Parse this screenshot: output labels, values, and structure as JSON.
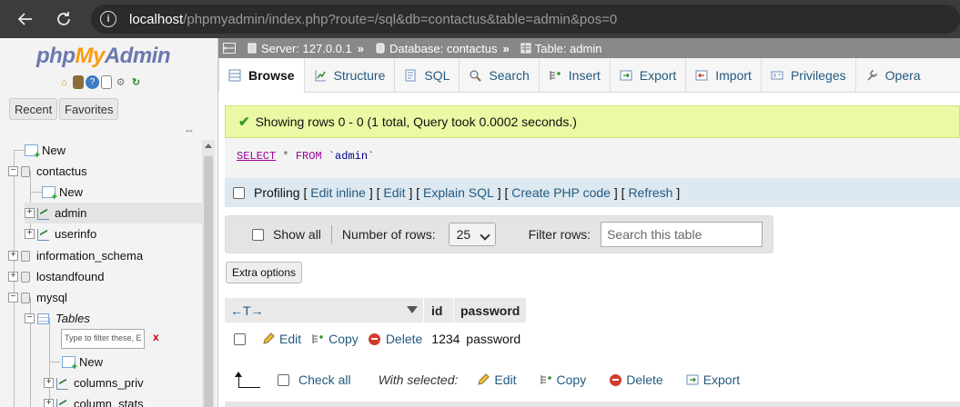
{
  "browser": {
    "url_host": "localhost",
    "url_path": "/phpmyadmin/index.php?route=/sql&db=contactus&table=admin&pos=0"
  },
  "sidebar": {
    "logo": {
      "php": "php",
      "my": "My",
      "admin": "Admin"
    },
    "recent_label": "Recent",
    "favorites_label": "Favorites",
    "tree": {
      "new_root": "New",
      "db_contactus": "contactus",
      "contactus_new": "New",
      "table_admin": "admin",
      "table_userinfo": "userinfo",
      "db_information_schema": "information_schema",
      "db_lostandfound": "lostandfound",
      "db_mysql": "mysql",
      "tables_label": "Tables",
      "filter_placeholder": "Type to filter these, E",
      "filter_clear": "x",
      "mysql_new": "New",
      "table_columns_priv": "columns_priv",
      "table_column_stats": "column_stats"
    }
  },
  "serverbar": {
    "server": "Server: 127.0.0.1",
    "database": "Database: contactus",
    "table": "Table: admin",
    "separator": "»"
  },
  "tabs": [
    {
      "label": "Browse",
      "icon": "browse-icon"
    },
    {
      "label": "Structure",
      "icon": "structure-icon"
    },
    {
      "label": "SQL",
      "icon": "sql-icon"
    },
    {
      "label": "Search",
      "icon": "search-icon"
    },
    {
      "label": "Insert",
      "icon": "insert-icon"
    },
    {
      "label": "Export",
      "icon": "export-icon"
    },
    {
      "label": "Import",
      "icon": "import-icon"
    },
    {
      "label": "Privileges",
      "icon": "privileges-icon"
    },
    {
      "label": "Opera",
      "icon": "operations-icon"
    }
  ],
  "main": {
    "success_message": "Showing rows 0 - 0 (1 total, Query took 0.0002 seconds.)",
    "sql": {
      "select": "SELECT",
      "star": "*",
      "from": "FROM",
      "table": "`admin`"
    },
    "profiling": {
      "label": "Profiling",
      "edit_inline": "Edit inline",
      "edit": "Edit",
      "explain": "Explain SQL",
      "create_php": "Create PHP code",
      "refresh": "Refresh",
      "lb": "[",
      "rb": "]",
      "sep": "] ["
    },
    "navigation": {
      "show_all": "Show all",
      "number_of_rows_label": "Number of rows:",
      "number_of_rows_value": "25",
      "filter_rows_label": "Filter rows:",
      "filter_placeholder": "Search this table"
    },
    "extra_options": "Extra options",
    "result": {
      "arrows": "←T→",
      "columns": [
        "id",
        "password"
      ],
      "rows": [
        {
          "id": "1234",
          "password": "password"
        }
      ],
      "row_actions": {
        "edit": "Edit",
        "copy": "Copy",
        "delete": "Delete"
      }
    },
    "bottom": {
      "check_all": "Check all",
      "with_selected": "With selected:",
      "edit": "Edit",
      "copy": "Copy",
      "delete": "Delete",
      "export": "Export"
    }
  },
  "colors": {
    "link": "#235a81",
    "success_bg": "#ebf8a4",
    "serverbar_bg": "#888888",
    "browser_bg": "#3c3c3c"
  }
}
